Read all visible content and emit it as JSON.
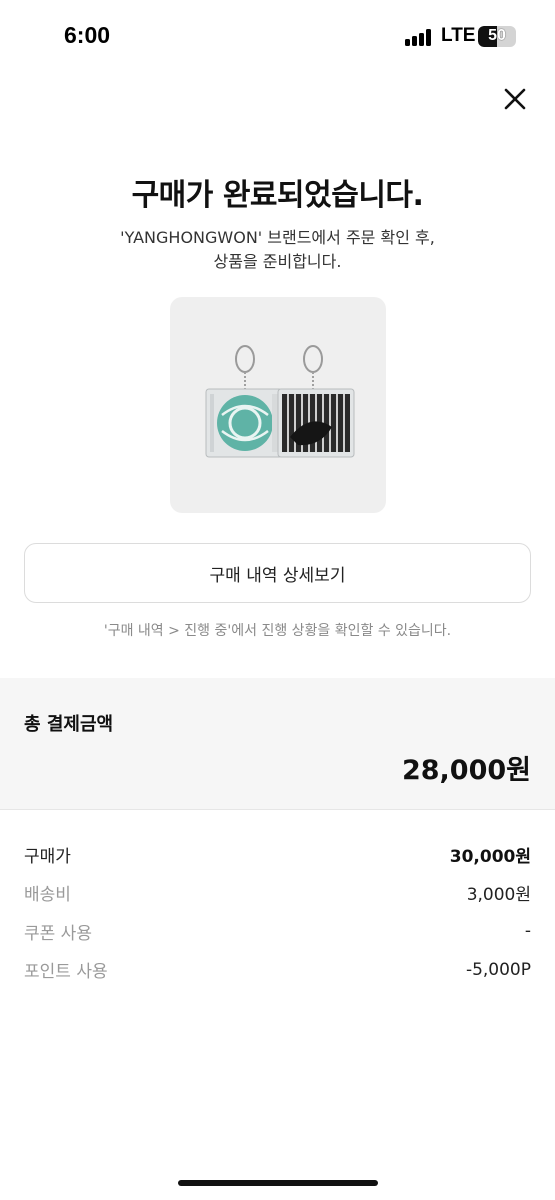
{
  "status_bar": {
    "time": "6:00",
    "network": "LTE",
    "battery": "50",
    "battery_level_percent": 50,
    "signal_icon": "signal-bars-icon"
  },
  "header": {
    "close_icon": "close-icon",
    "title": "구매가 완료되었습니다.",
    "subtitle_line1": "'YANGHONGWON' 브랜드에서 주문 확인 후,",
    "subtitle_line2": "상품을 준비합니다."
  },
  "product": {
    "image_icon": "keyring-product-image"
  },
  "actions": {
    "detail_button_label": "구매 내역 상세보기",
    "hint": "'구매 내역 > 진행 중'에서 진행 상황을 확인할 수 있습니다."
  },
  "total": {
    "label": "총 결제금액",
    "value": "28,000원"
  },
  "breakdown": [
    {
      "label": "구매가",
      "value": "30,000원"
    },
    {
      "label": "배송비",
      "value": "3,000원"
    },
    {
      "label": "쿠폰 사용",
      "value": "-"
    },
    {
      "label": "포인트 사용",
      "value": "-5,000P"
    }
  ],
  "colors": {
    "background": "#ffffff",
    "section_bg": "#f6f6f6",
    "text_primary": "#111111",
    "text_muted": "#9a9a9a",
    "product_bg": "#efefef"
  }
}
